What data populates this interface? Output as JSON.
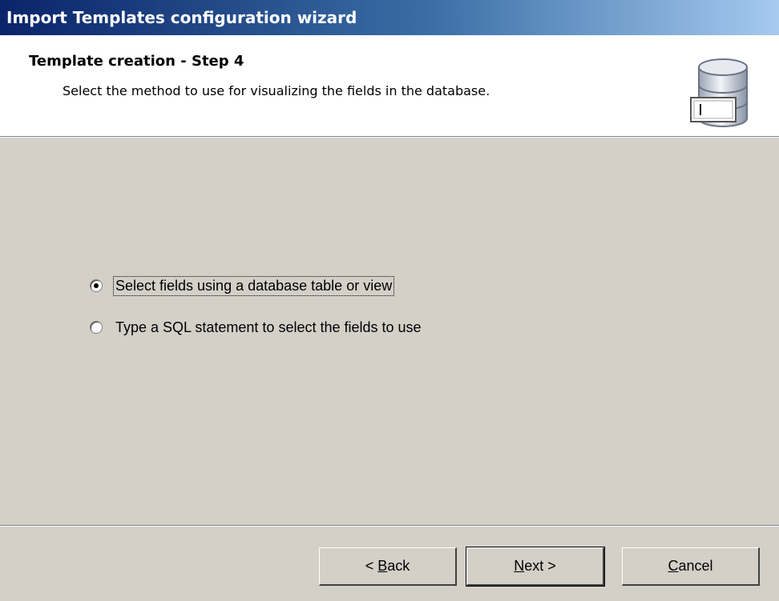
{
  "window": {
    "title": "Import Templates configuration wizard"
  },
  "header": {
    "title": "Template creation - Step 4",
    "subtitle": "Select the method to use for visualizing the fields in the database.",
    "icon": "database-icon"
  },
  "options": [
    {
      "label": "Select fields using a database table or view",
      "selected": true
    },
    {
      "label": "Type a SQL statement to select the fields to use",
      "selected": false
    }
  ],
  "buttons": {
    "back": {
      "prefix": "< ",
      "mnemonic": "B",
      "rest": "ack"
    },
    "next": {
      "prefix": "",
      "mnemonic": "N",
      "rest": "ext >"
    },
    "cancel": {
      "prefix": "",
      "mnemonic": "C",
      "rest": "ancel"
    }
  },
  "colors": {
    "title_start": "#0a246a",
    "title_end": "#a6caf0",
    "face": "#d4d0c8"
  }
}
